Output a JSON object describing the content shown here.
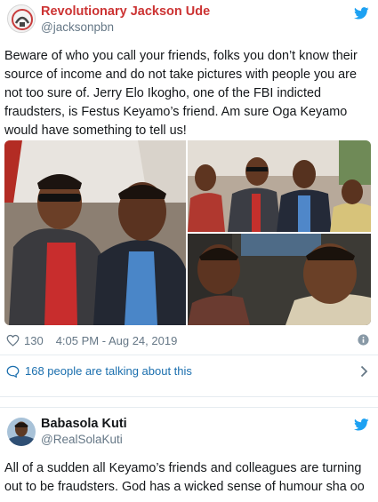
{
  "tweet1": {
    "name": "Revolutionary Jackson Ude",
    "handle": "@jacksonpbn",
    "text": "Beware of who you call your friends, folks you don’t know their source of income and do not take pictures with people you are not too sure of. Jerry Elo Ikogho, one of the FBI indicted fraudsters, is Festus Keyamo’s friend. Am sure Oga Keyamo would have something to tell us!",
    "likes": "130",
    "timestamp": "4:05 PM - Aug 24, 2019",
    "talking": "168 people are talking about this",
    "icons": {
      "bird": "twitter-bird-icon",
      "like": "heart-icon",
      "info": "info-icon",
      "talk": "comment-bubble-icon",
      "more": "chevron-right-icon"
    }
  },
  "tweet2": {
    "name": "Babasola Kuti",
    "handle": "@RealSolaKuti",
    "text": "All of a sudden all Keyamo’s friends and colleagues are turning out to be fraudsters. God has a wicked sense of humour sha oo"
  },
  "colors": {
    "twitter_blue": "#1da1f2",
    "link_blue": "#1b6fae",
    "name_red": "#cc3333",
    "muted": "#657786"
  }
}
